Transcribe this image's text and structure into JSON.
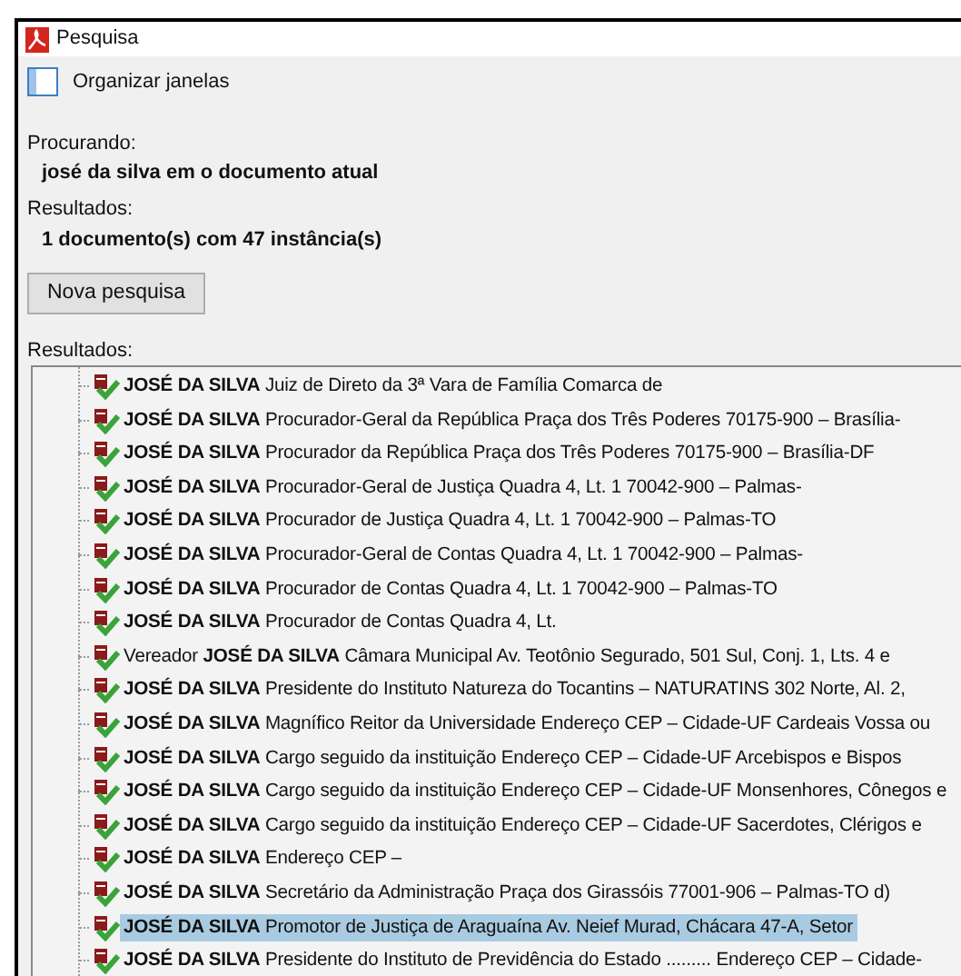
{
  "window": {
    "title": "Pesquisa"
  },
  "toolbar": {
    "label": "Organizar janelas"
  },
  "searching": {
    "label": "Procurando:",
    "value": "josé da silva em o documento atual"
  },
  "summary": {
    "label": "Resultados:",
    "value": "1 documento(s) com 47 instância(s)"
  },
  "buttons": [
    "Nova pesquisa"
  ],
  "results": {
    "label": "Resultados:",
    "items": [
      {
        "text": "**JOSÉ DA SILVA** Juiz de Direto da 3ª Vara de Família Comarca de",
        "selected": false
      },
      {
        "text": "**JOSÉ DA SILVA** Procurador-Geral da República Praça dos Três Poderes 70175-900 – Brasília-",
        "selected": false
      },
      {
        "text": "**JOSÉ DA SILVA** Procurador da República Praça dos Três Poderes 70175-900 – Brasília-DF",
        "selected": false
      },
      {
        "text": "**JOSÉ DA SILVA** Procurador-Geral de Justiça Quadra 4, Lt. 1 70042-900 – Palmas-",
        "selected": false
      },
      {
        "text": "**JOSÉ DA SILVA** Procurador de Justiça Quadra 4, Lt. 1 70042-900 – Palmas-TO",
        "selected": false
      },
      {
        "text": "**JOSÉ DA SILVA** Procurador-Geral de Contas Quadra 4, Lt. 1 70042-900 – Palmas-",
        "selected": false
      },
      {
        "text": "**JOSÉ DA SILVA** Procurador de Contas Quadra 4, Lt. 1 70042-900 – Palmas-TO",
        "selected": false
      },
      {
        "text": "**JOSÉ DA SILVA** Procurador de Contas Quadra 4, Lt.",
        "selected": false
      },
      {
        "text": "Vereador **JOSÉ DA SILVA** Câmara Municipal Av. Teotônio Segurado, 501 Sul, Conj. 1, Lts. 4 e",
        "selected": false
      },
      {
        "text": "**JOSÉ DA SILVA** Presidente do Instituto Natureza do Tocantins – NATURATINS 302 Norte, Al. 2,",
        "selected": false
      },
      {
        "text": "**JOSÉ DA SILVA** Magnífico Reitor da Universidade Endereço CEP – Cidade-UF Cardeais Vossa ou",
        "selected": false
      },
      {
        "text": "**JOSÉ DA SILVA** Cargo seguido da instituição Endereço CEP – Cidade-UF Arcebispos e Bispos",
        "selected": false
      },
      {
        "text": "**JOSÉ DA SILVA** Cargo seguido da instituição Endereço CEP – Cidade-UF Monsenhores, Cônegos e",
        "selected": false
      },
      {
        "text": "**JOSÉ DA SILVA** Cargo seguido da instituição Endereço CEP – Cidade-UF Sacerdotes, Clérigos e",
        "selected": false
      },
      {
        "text": "**JOSÉ DA SILVA** Endereço CEP –",
        "selected": false
      },
      {
        "text": "**JOSÉ DA SILVA** Secretário da Administração Praça dos Girassóis 77001-906 – Palmas-TO d)",
        "selected": false
      },
      {
        "text": "**JOSÉ DA SILVA** Promotor de Justiça de Araguaína Av. Neief Murad, Chácara 47-A, Setor",
        "selected": true
      },
      {
        "text": "**JOSÉ DA SILVA** Presidente do Instituto de Previdência do Estado ......... Endereço CEP – Cidade-",
        "selected": false
      }
    ]
  }
}
